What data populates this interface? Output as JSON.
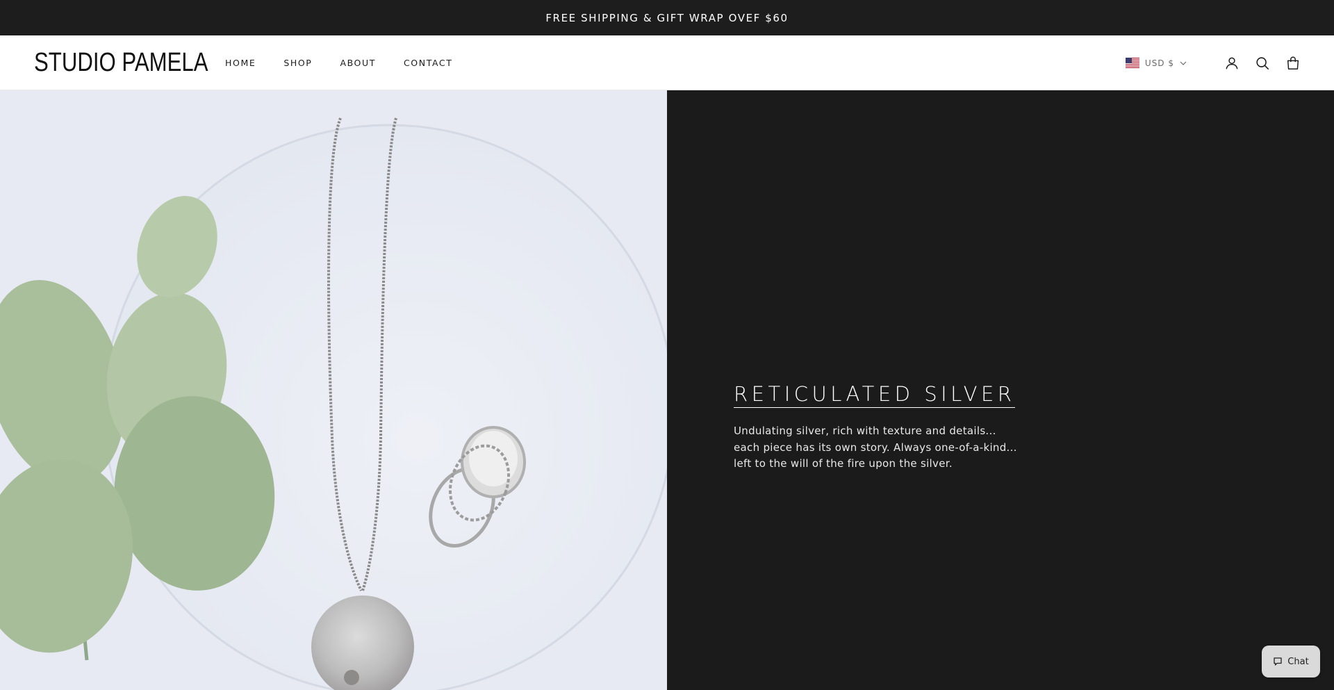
{
  "announcement": {
    "text": "FREE SHIPPING & GIFT WRAP OVEF $60"
  },
  "header": {
    "logo": "STUDIO PAMELA",
    "nav": [
      {
        "label": "HOME"
      },
      {
        "label": "SHOP"
      },
      {
        "label": "ABOUT"
      },
      {
        "label": "CONTACT"
      }
    ],
    "currency": {
      "label": "USD $",
      "flag_icon": "us-flag-icon"
    },
    "icons": [
      "account-icon",
      "search-icon",
      "cart-icon"
    ]
  },
  "hero": {
    "image_alt": "silver-pendant-and-rings-with-eucalyptus",
    "title": "RETICULATED SILVER",
    "description": "Undulating silver, rich with texture and details... each piece has its own story. Always one-of-a-kind... left to the will of the fire upon the silver."
  },
  "chat": {
    "label": "Chat"
  },
  "colors": {
    "announcement_bg": "#1d1d1d",
    "hero_panel_bg": "#1b1b1b",
    "accent_text": "#ffffff"
  }
}
